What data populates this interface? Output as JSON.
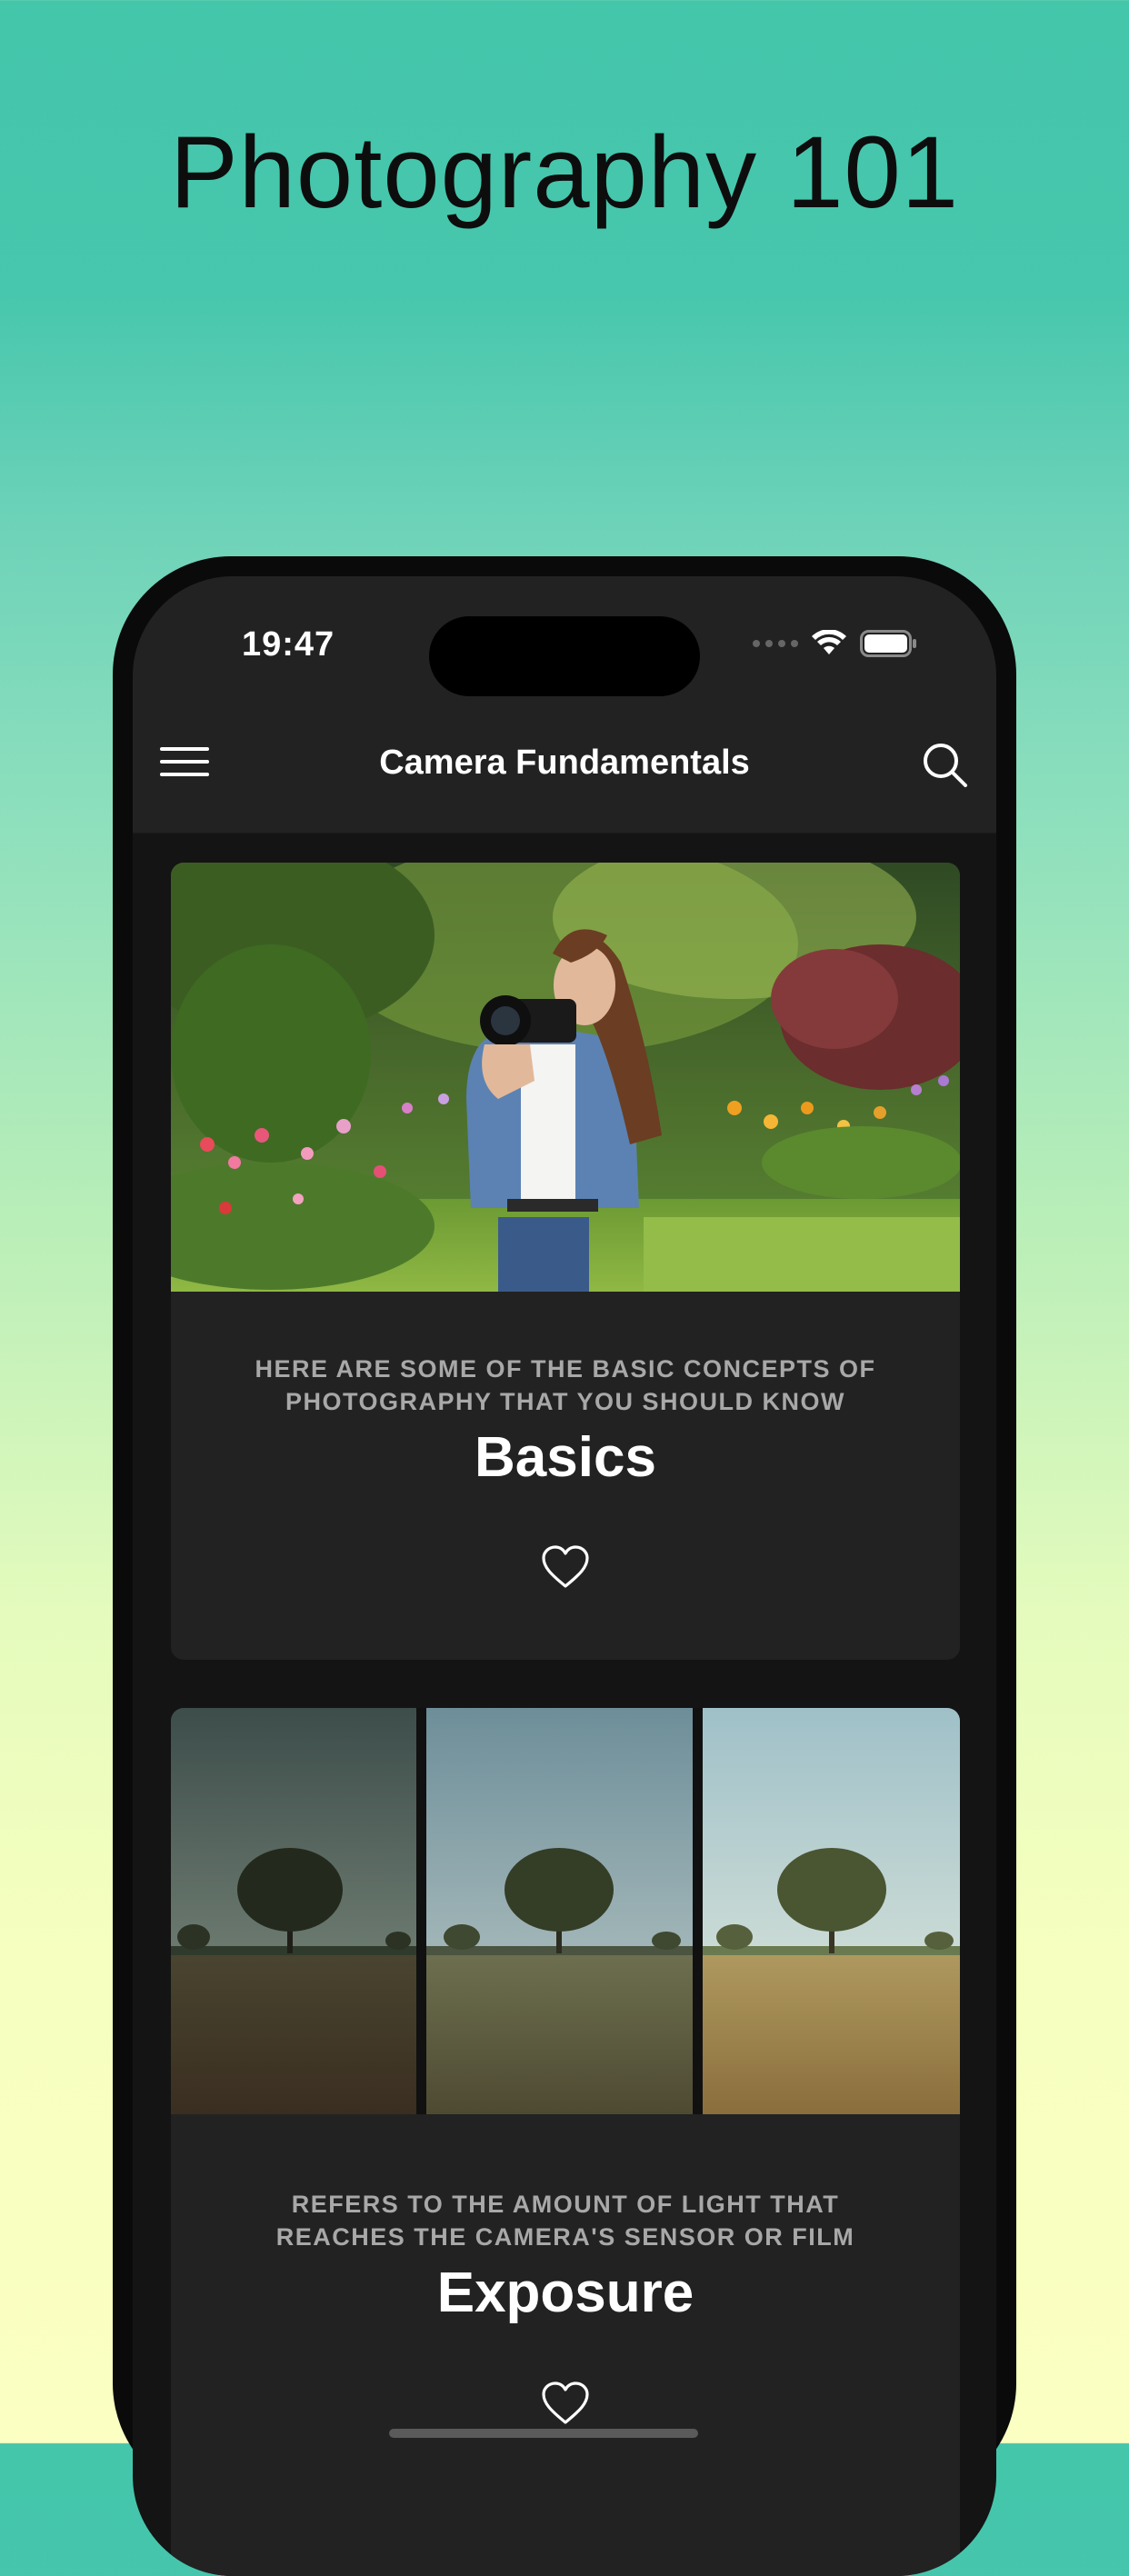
{
  "headline": "Photography 101",
  "status_bar": {
    "time": "19:47"
  },
  "nav": {
    "title": "Camera Fundamentals"
  },
  "cards": [
    {
      "caption": "HERE ARE SOME OF THE BASIC CONCEPTS OF PHOTOGRAPHY THAT YOU SHOULD KNOW",
      "title": "Basics",
      "image": "woman-with-camera-in-garden-photo"
    },
    {
      "caption": "REFERS TO THE AMOUNT OF LIGHT THAT REACHES THE CAMERA'S SENSOR OR FILM",
      "title": "Exposure",
      "image": "tree-field-three-exposures-photo"
    }
  ],
  "colors": {
    "background_top": "#44c6ab",
    "background_bottom": "#fbffc2",
    "phone_frame": "#0a0a0a",
    "bar_background": "#222222",
    "card_background": "#222222",
    "caption_text": "#a8a8a8"
  }
}
